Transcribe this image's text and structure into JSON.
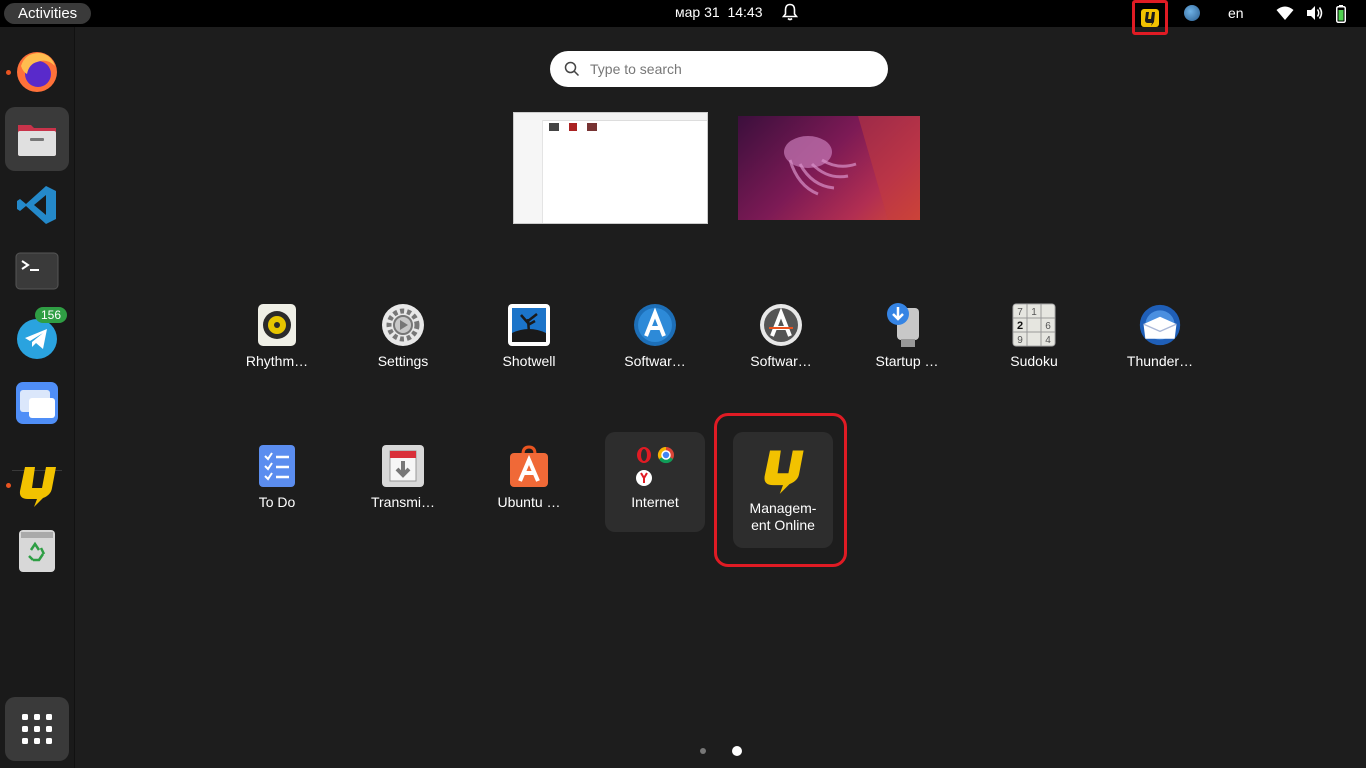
{
  "topbar": {
    "activities_label": "Activities",
    "date": "мар 31",
    "time": "14:43",
    "language": "en",
    "icons": [
      "bell-icon",
      "ulogic-tray-icon",
      "globe-icon",
      "wifi-icon",
      "volume-icon",
      "battery-icon"
    ]
  },
  "dock": {
    "items": [
      {
        "name": "Firefox",
        "icon": "firefox-icon",
        "running": true
      },
      {
        "name": "Files",
        "icon": "files-icon",
        "running": true,
        "active": true
      },
      {
        "name": "Visual Studio Code",
        "icon": "vscode-icon",
        "running": false
      },
      {
        "name": "Terminal",
        "icon": "terminal-icon",
        "running": false
      },
      {
        "name": "Telegram",
        "icon": "telegram-icon",
        "running": false,
        "badge": "156"
      },
      {
        "name": "Window Manager",
        "icon": "window-icon",
        "running": false
      },
      {
        "name": "Management Online",
        "icon": "ulogic-icon",
        "running": true
      },
      {
        "name": "Trash",
        "icon": "trash-icon",
        "running": false
      },
      {
        "name": "Show Applications",
        "icon": "app-grid-icon",
        "running": false
      }
    ]
  },
  "search": {
    "placeholder": "Type to search",
    "value": ""
  },
  "apps": {
    "row1": [
      {
        "label": "Rhythm…",
        "icon": "rhythmbox-icon"
      },
      {
        "label": "Settings",
        "icon": "settings-icon"
      },
      {
        "label": "Shotwell",
        "icon": "shotwell-icon"
      },
      {
        "label": "Softwar…",
        "icon": "software-icon"
      },
      {
        "label": "Softwar…",
        "icon": "software-updater-icon"
      },
      {
        "label": "Startup …",
        "icon": "startup-disk-icon"
      },
      {
        "label": "Sudoku",
        "icon": "sudoku-icon"
      },
      {
        "label": "Thunder…",
        "icon": "thunderbird-icon"
      }
    ],
    "row2": [
      {
        "label": "To Do",
        "icon": "todo-icon"
      },
      {
        "label": "Transmi…",
        "icon": "transmission-icon"
      },
      {
        "label": "Ubuntu …",
        "icon": "ubuntu-software-icon"
      },
      {
        "label": "Internet",
        "icon": "internet-folder-icon"
      },
      {
        "label": "Managem-\nent Online",
        "icon": "ulogic-icon"
      }
    ]
  },
  "sudoku_digits": [
    "7",
    "1",
    "2",
    "6",
    "9",
    "4"
  ],
  "pages": {
    "count": 2,
    "current": 2
  },
  "colors": {
    "highlight": "#e01b24",
    "ubuntu_orange": "#e95420",
    "badge_green": "#2f9e44"
  }
}
